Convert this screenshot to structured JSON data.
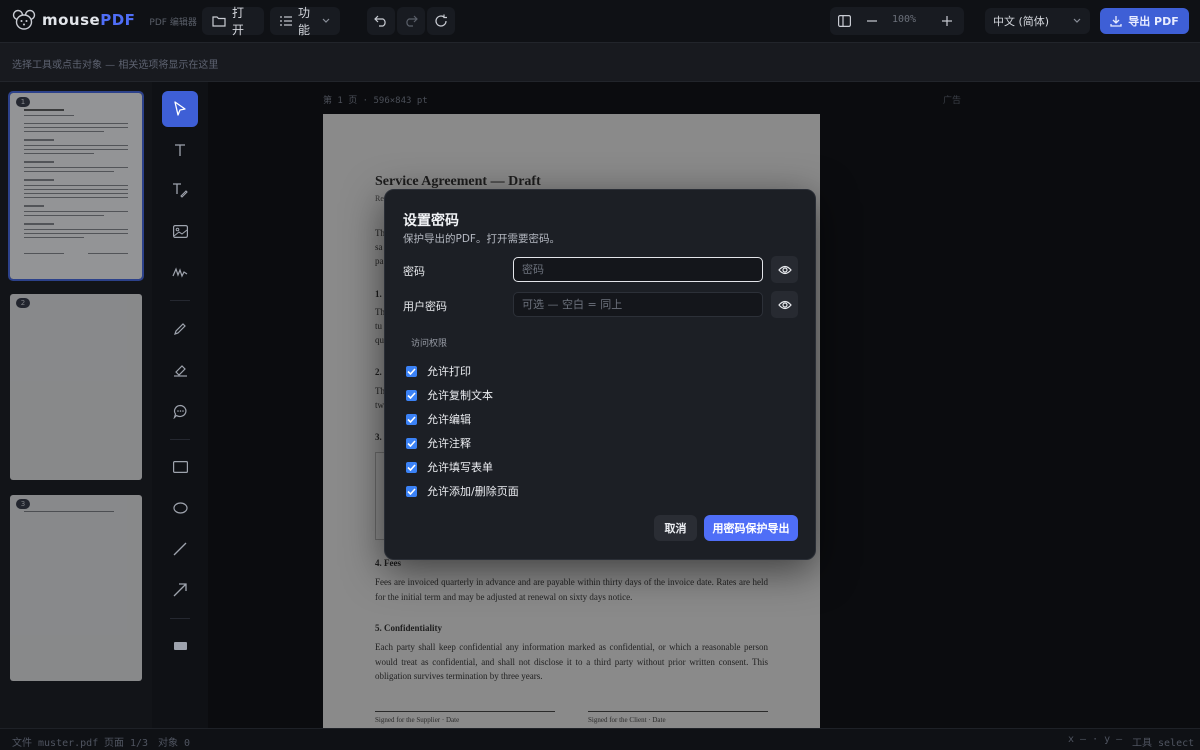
{
  "app": {
    "logo_prefix": "mouse",
    "logo_suffix": "PDF",
    "logo_subtitle": "PDF 编辑器"
  },
  "toolbar": {
    "open_label": "打开",
    "features_label": "功能",
    "zoom": "100%",
    "language": "中文 (简体)",
    "export_label": "导出 PDF"
  },
  "options_bar": {
    "hint": "选择工具或点击对象 — 相关选项将显示在这里"
  },
  "thumbnails": [
    {
      "number": "1"
    },
    {
      "number": "2"
    },
    {
      "number": "3"
    }
  ],
  "canvas": {
    "page_info": "第 1 页 · 596×843 pt",
    "right_label": "广告"
  },
  "document": {
    "title": "Service Agreement — Draft",
    "fragments": {
      "f1": "Re",
      "f2": "Th",
      "f3": "sa",
      "f4": "pa",
      "h1": "1.",
      "f5": "Th",
      "f6": "tu",
      "f7": "qu",
      "h2": "2.",
      "f8": "Th",
      "f9": "tw",
      "h3": "3."
    },
    "section4_heading": "4. Fees",
    "section4_text": "Fees are invoiced quarterly in advance and are payable within thirty days of the invoice date. Rates are held for the initial term and may be adjusted at renewal on sixty days notice.",
    "section5_heading": "5. Confidentiality",
    "section5_text": "Each party shall keep confidential any information marked as confidential, or which a reasonable person would treat as confidential, and shall not disclose it to a third party without prior written consent. This obligation survives termination by three years.",
    "signature_supplier": "Signed for the Supplier · Date",
    "signature_client": "Signed for the Client · Date"
  },
  "status_bar": {
    "file": "文件 muster.pdf",
    "page": "页面 1/3",
    "objects": "对象 0",
    "coords": "x — · y —",
    "tool": "工具 select"
  },
  "modal": {
    "title": "设置密码",
    "subtitle": "保护导出的PDF。打开需要密码。",
    "password_label": "密码",
    "password_placeholder": "密码",
    "user_password_label": "用户密码",
    "user_password_placeholder": "可选 — 空白 = 同上",
    "permissions_heading": "访问权限",
    "permissions": [
      {
        "label": "允许打印",
        "checked": true
      },
      {
        "label": "允许复制文本",
        "checked": true
      },
      {
        "label": "允许编辑",
        "checked": true
      },
      {
        "label": "允许注释",
        "checked": true
      },
      {
        "label": "允许填写表单",
        "checked": true
      },
      {
        "label": "允许添加/删除页面",
        "checked": true
      }
    ],
    "cancel_label": "取消",
    "confirm_label": "用密码保护导出"
  },
  "colors": {
    "accent": "#4f6ef7",
    "checkbox": "#3b82f6",
    "background": "#0f1115",
    "modal_bg": "#1c1f25"
  }
}
